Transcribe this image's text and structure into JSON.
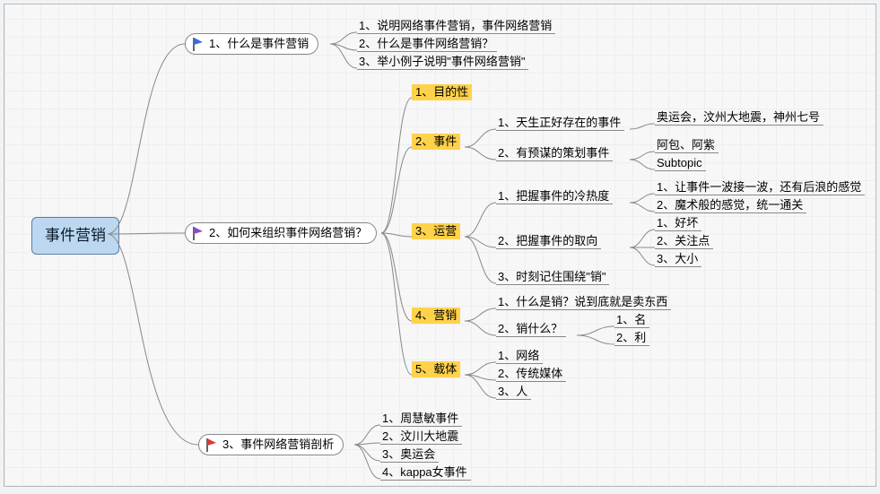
{
  "root": "事件营销",
  "main1": {
    "label": "1、什么是事件营销",
    "flag": "blue"
  },
  "main2": {
    "label": "2、如何来组织事件网络营销？",
    "flag": "purple"
  },
  "main3": {
    "label": "3、事件网络营销剖析",
    "flag": "red"
  },
  "b1": {
    "c1": "1、说明网络事件营销，事件网络营销",
    "c2": "2、什么是事件网络营销？",
    "c3": "3、举小例子说明\"事件网络营销\""
  },
  "b2": {
    "c1": "1、目的性",
    "c2": "2、事件",
    "c2_1": "1、天生正好存在的事件",
    "c2_1_1": "奥运会，汶州大地震，神州七号",
    "c2_2": "2、有预谋的策划事件",
    "c2_2_1": "阿包、阿紫",
    "c2_2_2": "Subtopic",
    "c3": "3、运营",
    "c3_1": "1、把握事件的冷热度",
    "c3_1_1": "1、让事件一波接一波，还有后浪的感觉",
    "c3_1_2": "2、魔术般的感觉，统一通关",
    "c3_2": "2、把握事件的取向",
    "c3_2_1": "1、好坏",
    "c3_2_2": "2、关注点",
    "c3_2_3": "3、大小",
    "c3_3": "3、时刻记住围绕\"销\"",
    "c4": "4、营销",
    "c4_1": "1、什么是销？说到底就是卖东西",
    "c4_2": "2、销什么？",
    "c4_2_1": "1、名",
    "c4_2_2": "2、利",
    "c5": "5、载体",
    "c5_1": "1、网络",
    "c5_2": "2、传统媒体",
    "c5_3": "3、人"
  },
  "b3": {
    "c1": "1、周慧敏事件",
    "c2": "2、汶川大地震",
    "c3": "3、奥运会",
    "c4": "4、kappa女事件"
  }
}
